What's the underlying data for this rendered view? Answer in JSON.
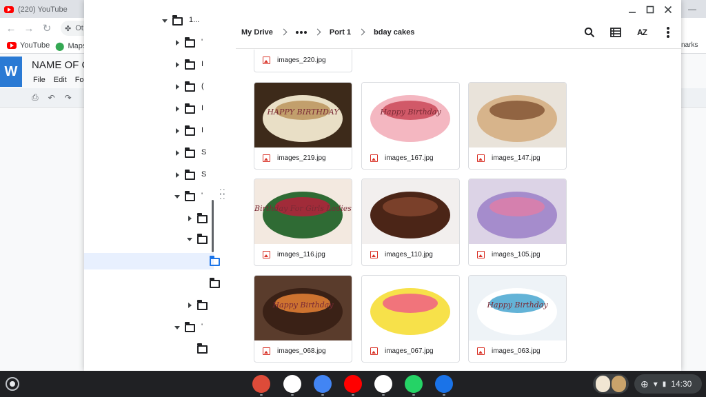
{
  "background_browser": {
    "tab_title": "(220) YouTube",
    "omnibox_text": "Ot",
    "bookmarks": [
      {
        "label": "YouTube",
        "icon": "youtube-icon"
      },
      {
        "label": "Maps",
        "icon": "maps-pin-icon"
      }
    ],
    "bookmarks_right_text": "narks"
  },
  "background_doc": {
    "app_letter": "W",
    "title": "NAME OF C",
    "menu": [
      "File",
      "Edit",
      "For"
    ]
  },
  "files": {
    "sidebar_tree": [
      {
        "depth": 0,
        "expanded": true,
        "label": "1..."
      },
      {
        "depth": 1,
        "expanded": false,
        "label": "'"
      },
      {
        "depth": 1,
        "expanded": false,
        "label": "I"
      },
      {
        "depth": 1,
        "expanded": false,
        "label": "("
      },
      {
        "depth": 1,
        "expanded": false,
        "label": "I"
      },
      {
        "depth": 1,
        "expanded": false,
        "label": "I"
      },
      {
        "depth": 1,
        "expanded": false,
        "label": "S"
      },
      {
        "depth": 1,
        "expanded": false,
        "label": "S"
      },
      {
        "depth": 1,
        "expanded": true,
        "label": "'"
      },
      {
        "depth": 2,
        "expanded": false,
        "label": ""
      },
      {
        "depth": 2,
        "expanded": true,
        "label": ""
      },
      {
        "depth": 3,
        "expanded": null,
        "label": "",
        "selected": true
      },
      {
        "depth": 3,
        "expanded": null,
        "label": ""
      },
      {
        "depth": 2,
        "expanded": false,
        "label": ""
      },
      {
        "depth": 1,
        "expanded": true,
        "label": "'"
      },
      {
        "depth": 2,
        "expanded": null,
        "label": ""
      }
    ],
    "breadcrumb": {
      "root": "My Drive",
      "more": "more-horiz-icon",
      "items": [
        "Port 1",
        "bday cakes"
      ]
    },
    "toolbar_icons": [
      "search-icon",
      "list-view-icon",
      "sort-az-icon",
      "more-vert-icon"
    ],
    "sort_label": "AZ",
    "partial_file": "images_220.jpg",
    "files": [
      {
        "name": "images_219.jpg",
        "colors": [
          "#3d2a1a",
          "#e9dfc6",
          "#b48a4e"
        ],
        "overlay": "HAPPY BIRTHDAY"
      },
      {
        "name": "images_167.jpg",
        "colors": [
          "#ffffff",
          "#f4b7c1",
          "#c53a4a"
        ],
        "overlay": "Happy Birthday"
      },
      {
        "name": "images_147.jpg",
        "colors": [
          "#e9e3da",
          "#d7b48b",
          "#7a4a2a"
        ],
        "overlay": ""
      },
      {
        "name": "images_116.jpg",
        "colors": [
          "#f3e9e0",
          "#2f6b34",
          "#c8153b"
        ],
        "overlay": "Birthday For Girls Ladies"
      },
      {
        "name": "images_110.jpg",
        "colors": [
          "#f2efee",
          "#4b2517",
          "#8a4a32"
        ],
        "overlay": ""
      },
      {
        "name": "images_105.jpg",
        "colors": [
          "#dcd3e6",
          "#a58ccc",
          "#e57ca4"
        ],
        "overlay": ""
      },
      {
        "name": "images_068.jpg",
        "colors": [
          "#5a3c2c",
          "#3a2116",
          "#ff8f3a"
        ],
        "overlay": "Happy Birthday"
      },
      {
        "name": "images_067.jpg",
        "colors": [
          "#ffffff",
          "#f7e14a",
          "#ef4f8c"
        ],
        "overlay": ""
      },
      {
        "name": "images_063.jpg",
        "colors": [
          "#eef3f7",
          "#ffffff",
          "#2f9ac9"
        ],
        "overlay": "Happy Birthday"
      }
    ]
  },
  "shelf": {
    "apps": [
      {
        "name": "chrome-icon",
        "color": "#dd4b39"
      },
      {
        "name": "gmail-icon",
        "color": "#ffffff"
      },
      {
        "name": "docs-icon",
        "color": "#4285f4"
      },
      {
        "name": "youtube-icon",
        "color": "#ff0000"
      },
      {
        "name": "play-store-icon",
        "color": "#ffffff"
      },
      {
        "name": "whatsapp-icon",
        "color": "#25d366"
      },
      {
        "name": "files-icon",
        "color": "#1a73e8"
      }
    ],
    "time": "14:30"
  }
}
